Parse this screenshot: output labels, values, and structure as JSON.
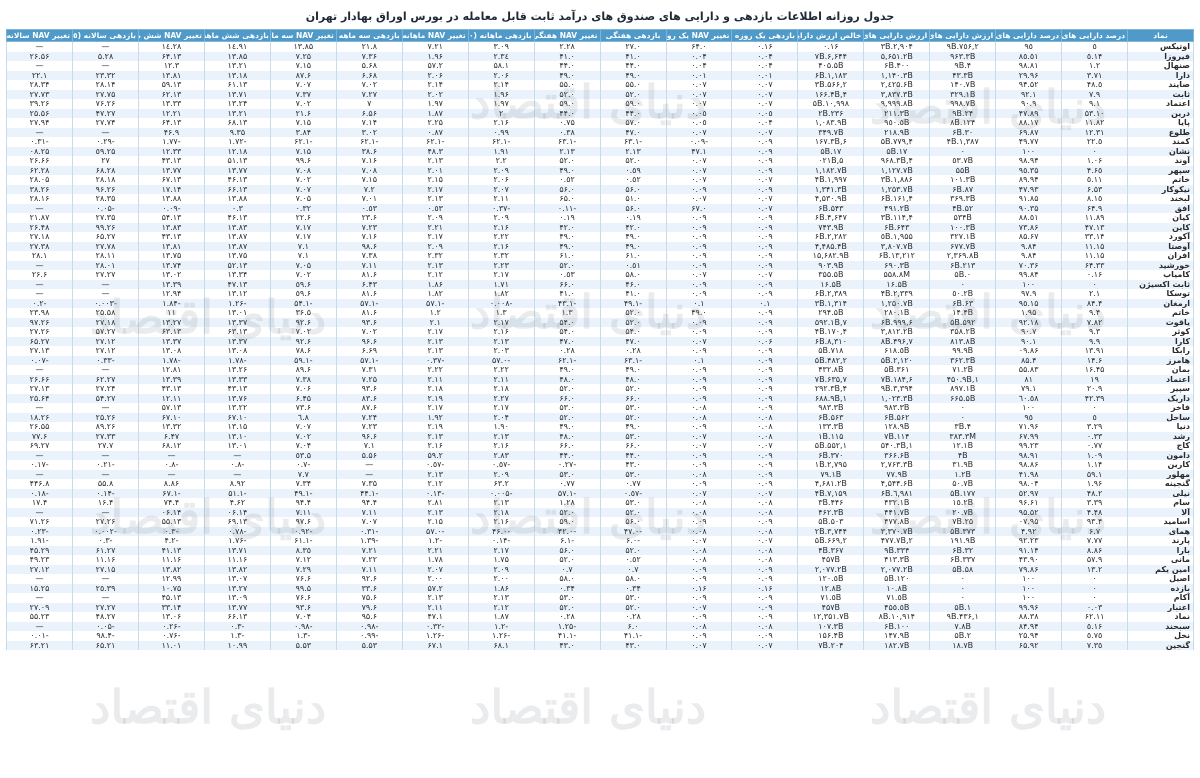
{
  "title": "جدول روزانه اطلاعات بازدهی و دارایی های صندوق های درآمد ثابت قابل معامله در بورس اوراق بهادار تهران",
  "watermark": "دنیای اقتصاد",
  "columns": [
    "نماد",
    "درصد دارایی های پرریسک",
    "درصد دارایی های کم ریسک",
    "ارزش دارایی های پرریسک",
    "ارزش دارایی های کم ریسک",
    "خالص ارزش دارایی ها",
    "بازدهی یک روزه",
    "تغییر NAV یک روزه",
    "بازدهی هفتگی",
    "تغییر NAV هفتگی (٧روزه)",
    "بازدهی ماهانه (٣٠روزه)",
    "تغییر NAV ماهانه (٣٠روزه)",
    "بازدهی سه ماهه (٩٠روزه)",
    "تغییر NAV سه ماهه (٩٠روزه)",
    "بازدهی شش ماهه (١٨٠روزه)",
    "تغییر NAV شش ماهه (١٨٠روزه)",
    "بازدهی سالانه (٣۶٥روزه)",
    "تغییر NAV سالانه (٣۶٥روزه)"
  ],
  "rows": [
    [
      "اوتیکس",
      "٥",
      "٩٥",
      "۲,٧٥۶.٩B",
      "۲,۹٠۴.٣B",
      "٠.١۶",
      "٠.١۶",
      "٠.۶۴",
      "٠.۲٧",
      "٢.٢٨",
      "٣.٠٩",
      "٧.٢١",
      "٨.۲١",
      "١٣.٨۵",
      "١٤.٩١",
      "١٤.٢٨",
      "—",
      "—"
    ],
    [
      "فیروزا",
      "١۴.٥",
      "٨٥.٥١",
      "۹۶٣.٣B",
      "۵,۶۵١.٢B",
      "۶,۶۴۴.٧B",
      "٠.٠۴",
      "٠.٠۴",
      "٠.۴١",
      "٠.۴١",
      "٢.٣٤",
      "١.٩۶",
      "٧.٣۶",
      "٧.٢۵",
      "١٣.٨۵",
      "١٣.۶۴",
      "٢٨.۵",
      "٢۶.۵۶"
    ],
    [
      "صنهال",
      "١.٢",
      "٩٨.٨١",
      "۴.٩B",
      "۴٠٠.۶B",
      "۴٠۵.۵B",
      "٠.٠۴",
      "٠.٠۴",
      "٠.۴۴",
      "٠.۴۴",
      "١.۵٨",
      "٢.۵٧",
      "۵.۶٨",
      "٧.١۵",
      "١٣.٢١",
      "١٢.٣",
      "—",
      "—"
    ],
    [
      "دارا",
      "٣.٧١",
      "٩۶.٢٩",
      "۴٣.٣B",
      "١,١۴٠.٣B",
      "١,١٨٣.۶B",
      "٠.٠١",
      "٠.٠١",
      "٠.۴٩",
      "٠.۴٩",
      "٢.٠۶",
      "٢.٠۶",
      "۶.۶٨",
      "۶.٨٧",
      "١٣.١٨",
      "١٣.٨١",
      "٢٣.٣٢",
      "٢٢.١"
    ],
    [
      "صایند",
      "٥.۴٨",
      "٩۴.۵٢",
      "١۴٠.٧B",
      "٢,٤٢۵.۶B",
      "٢,۵۶۶.٣B",
      "٠.٠٧",
      "٠.٠٧",
      "٠.۵۵",
      "٠.۵۵",
      "٢.١۴",
      "٢.١۴",
      "٧.٠٢",
      "٧.٠٧",
      "١٣.۶١",
      "١٣.۵٩",
      "٢٨.١۴",
      "٢٨.٣۴"
    ],
    [
      "ثابت",
      "٧.٩",
      "٩٢.١",
      "٣٢٩.١B",
      "٣,٨٣٧.٣B",
      "۴,١۶۶.۴B",
      "٠.٠٧",
      "٠.٠٧",
      "٠.۵۲",
      "٠.۵۲",
      "١.٩۶",
      "٢.٠٢",
      "٧.٢٧",
      "٧.٣٧",
      "١٣.٧١",
      "١٣.۶٢",
      "٢٧.٧۵",
      "٢٧.٧٣"
    ],
    [
      "اعتماد",
      "٩.١",
      "٩٠.٩",
      "٩٩٨.٧B",
      "٩,٩٩٩.٨B",
      "١٠,٩٩٨.۵B",
      "٠.٠٧",
      "٠.٠٧",
      "٠.۵٩",
      "٠.۵٩",
      "١.٩٧",
      "١.٩٧",
      "٧",
      "٧.٠٢",
      "١٣.٢۴",
      "١٣.٣٣",
      "٢۶.٧۶",
      "٢۶.٣٩"
    ],
    [
      "درین",
      "١٠.۵٣",
      "٨٩.۴٧",
      "٢۴.٩B",
      "٢١١.٣B",
      "٢٣۶.٢B",
      "٠.٠٥",
      "٠.٠٥",
      "٠.۴۴",
      "٠.۴۴",
      "٢",
      "١.٨٧",
      "۶.۵۶",
      "۶.٢١",
      "١٣.٢١",
      "١٢.٢١",
      "٢٧.۴٧",
      "٢۵.۵۶"
    ],
    [
      "پایا",
      "١١.٨٢",
      "٨٨.١٧",
      "١٢۴.٨B",
      "٩٥٠.٥B",
      "١,٠٨٣.٩B",
      "٠.٠۴",
      "٠.٠٥",
      "٠.۵٧",
      "٠.٧۵",
      "٢.١۶",
      "٢.٢۵",
      "٧.١۴",
      "٧.١۵",
      "١٣.۶٨",
      "١٣.۶۴",
      "٢٧.٧۴",
      "٢٧.٩۴"
    ],
    [
      "طلوع",
      "١٢.٣١",
      "٨٧.۶٩",
      "٣٠.۶B",
      "٢١٨.٩B",
      "٣۴٩.٧B",
      "٠.٠٧",
      "٠.٠٧",
      "٠.۴٧",
      "٠.٣٨",
      "٠.٩٩",
      "٠.٨٧",
      "٣.٠٢",
      "٣.٨۴",
      "٩.٣۵",
      "٩.۴۶",
      "—",
      "—"
    ],
    [
      "کمند",
      "٢٢.٥",
      "٧٧.۴٩",
      "١,٣٨٧.۴B",
      "۴,٧٧٩.۵B",
      "۶,١۶٧.٣B",
      "٠.٠٩",
      "-٠.٠٩",
      "-١.۶٣",
      "-١.۶٣",
      "-١.۶٢",
      "-١.۶٢",
      "-١.۶٢",
      "-١.۶٢",
      "-١.٧٢",
      "-١.٧٧",
      "-٠.٢٩",
      "-٠.٣١"
    ],
    [
      "نشان",
      "٠",
      "١٠٠",
      "٠",
      "١٧.۵B",
      "١٧.۵B",
      "٠.٠٩",
      "١.۴٧",
      "٢.١٣",
      "٢.١٣",
      "١.٩١",
      "٣.۴٨",
      "۶.٣٨",
      "٧.١۵",
      "١٢.١٨",
      "١٢.٣٣",
      "٢۵.٥٩",
      "٢۵.٠٨"
    ],
    [
      "آوند",
      "١.٠۶",
      "٩٨.٩۴",
      "٥٣.٧B",
      "۴,٩۶٨.٣B",
      "۵,٠٢١B",
      "٠.٠٩",
      "٠.٠٧",
      "٠.۵٢",
      "٠.۵٢",
      "٢.٢",
      "٢.١٣",
      "٧.١۶",
      "۶.٩٩",
      "١٣.۵١",
      "١٣.۴٣",
      "٢٧",
      "٢۶.۶۶"
    ],
    [
      "سپهر",
      "۴.۶٥",
      "٩٥.٣۵",
      "۵۵B",
      "١,١٢٧.٧B",
      "١,١٨٢.٧B",
      "٠.٠٩",
      "٠.٠٧",
      "٠.٥٩",
      "٠.۴٩",
      "٢.٠٩",
      "٢.٠١",
      "٧.٠٨",
      "٧.٠٨",
      "١٣.٧٧",
      "١٣.٧٧",
      "٢٨.۶٨",
      "٢٨.۶٢"
    ],
    [
      "خاتم",
      "٥.١١",
      "٩۴.٨٩",
      "١٠١.٣B",
      "١,٨٨۶.٣B",
      "١,٩٩٧.۴B",
      "٠.٠٧",
      "٠.٠٧",
      "٠.٥٢",
      "٠.٥٢",
      "٢.٠۶",
      "٢.١۵",
      "٧.١۵",
      "٧.٠٢",
      "١٣.۴۶",
      "١٣.۶٧",
      "٢٨.١٨",
      "٢٨.٠۵"
    ],
    [
      "نیکوکار",
      "۶.۵٣",
      "٩٣.۴٧",
      "٨٧.۶B",
      "١,٢۵٣.٧B",
      "١,٣۴١.٣B",
      "٠.٠٩",
      "٠.٠٩",
      "٠.۵۶",
      "٠.۵۶",
      "٢.٠٧",
      "٢.١٧",
      "٧.٢",
      "٧.٠٧",
      "١٣.۶۶",
      "١۴.١٧",
      "٢۶.٩۶",
      "٢۶.٣٨"
    ],
    [
      "لبخند",
      "٨.١٥",
      "٩١.٨۵",
      "٣۶٩.٣B",
      "۴,١۶١.۶B",
      "۴,۵٣٠.٩B",
      "٠.٠٧",
      "٠.٠٧",
      "٠.۵١",
      "٠.۶۵",
      "٢.١١",
      "٢.١٣",
      "٧.٠١",
      "٧.٠۵",
      "١٣.٨٨",
      "١٣.٨٨",
      "٢٨.٣۵",
      "٢٨.١۶"
    ],
    [
      "افق",
      "٩.۶۴",
      "٩٠.٣۵",
      "۵٢.۴B",
      "۴٩١.٢B",
      "۵۴٣.۶B",
      "٠.٠٧",
      "٠.۶٧",
      "٠.۵۶",
      "-٠.١١",
      "-٠.٣٧",
      "٠.٥٣",
      "٠.٥٣",
      "٠.٣٢",
      "٠.٣",
      "-٠.٠٩",
      "-٠.٠۵",
      "—"
    ],
    [
      "کیان",
      "١١.٨٩",
      "٨٨.٥١",
      "۵٣۴B",
      "۴,١١۴.٣B",
      "۴,۶۴٧.۶B",
      "٠.٠٩",
      "٠.٠٩",
      "٠.١٩",
      "٠.١٩",
      "٢.٠٩",
      "٢.٠٩",
      "۶.٢٣",
      "۶.٢٢",
      "١٣.۴۶",
      "١٣.۵۴",
      "٢٧.٣۵",
      "٢١.٨٧"
    ],
    [
      "کاین",
      "١٣.۴٧",
      "٨۶.٧٣",
      "١٠٠.٣B",
      "۶۴٣.۶B",
      "٧۴٣.٩B",
      "٠.٠٩",
      "٠.٠٩",
      "٠.۴٢",
      "٠.۴٢",
      "٢.١۶",
      "٢.٢١",
      "٧.٢٣",
      "٧.١٧",
      "١٣.٨٣",
      "١٣.٨٣",
      "٢۶.٩٩",
      "٢۶.۴٨"
    ],
    [
      "آکورد",
      "١۴.٣٣",
      "٨۵.۶٧",
      "٣٢٧.١B",
      "١,٩۵۵.٥B",
      "٢,٢٨٢.۶B",
      "٠.٠٩",
      "٠.٠٩",
      "٠.۴٩",
      "٠.۴٩",
      "٢.٢٢",
      "٢.١٧",
      "٧.١۶",
      "٧.١٧",
      "١٣.٨٧",
      "١٣.۴٣",
      "٢٧.۶۵",
      "٢٧.١٨"
    ],
    [
      "آوصتا",
      "١۵.١١",
      "٨۴.٩",
      "۶٧٧.٧B",
      "٣,٨٠٧.٧B",
      "۴,۴٨۵.۴B",
      "٠.٠٩",
      "٠.٠٩",
      "٠.۴٩",
      "٠.۴٩",
      "٢.١۶",
      "٢.٠٩",
      "۶.٩٨",
      "٧.١",
      "١٣.٨٧",
      "١٣.٨١",
      "٢٧.٧٨",
      "٢٧.٣٨"
    ],
    [
      "افران",
      "١۵.١١",
      "٨۴.٩",
      "٢,٣۶٩.٨B",
      "١٣,٢١٢.۶B",
      "١۵,۶٨٢.٩B",
      "٠.٠٩",
      "٠.٠٩",
      "٠.۶١",
      "٠.۶١",
      "٢.٣٢",
      "٢.٣٢",
      "٧.٣٨",
      "٧.١",
      "١٣.٧۵",
      "١٣.٧۵",
      "٢٨.١١",
      "٢٨.١"
    ],
    [
      "خورشید",
      "٣٣.۶۴",
      "٧٠.٣۶",
      "٢١٣.۶B",
      "۶٩٠.٣B",
      "٩٠٣.٩B",
      "٠.٠٩",
      "٠.٠٩",
      "٠.٥١",
      "٠.۵٢",
      "٢.٢٣",
      "٢.١٣",
      "٧.١١",
      "٧.٠۵",
      "١٣.۵٢",
      "١٣.٧۴",
      "٢٨.٠١",
      "—"
    ],
    [
      "کامیاب",
      "٠.١۶",
      "٩٩.٨۴",
      "٠.۵B",
      "۵۵٨.٨M",
      "٣۵۵.۵B",
      "٠.٠٧",
      "٠.٠٧",
      "٠.۵٨",
      "٠.٥٣",
      "٢.١٧",
      "٢.١٢",
      "۶.٨١",
      "٧.٠٢",
      "١٣.٣۴",
      "١٣.٠٢",
      "٢٧.٢٧",
      "٢۶.۶"
    ],
    [
      "ثابت اکسیژن",
      "٠",
      "١٠٠",
      "٠",
      "١۶.۵B",
      "١۶.۵B",
      "٠.٠٩",
      "٠.٠٩",
      "٠.۴۶",
      "٠.۶۶",
      "١.٧١",
      "١.٨۶",
      "۶.۴٣",
      "۶.٥٩",
      "١٣.۴٧",
      "١٣.٣٩",
      "—",
      "—"
    ],
    [
      "توسکا",
      "٢.١",
      "٩٧.٩",
      "٥٠.٢B",
      "٢,٣٣٩.۴B",
      "٢,٣٨٩.۶B",
      "٠.٠٩",
      "٠.٠٩",
      "٠.۴١",
      "٠.۴١",
      "١.٨٢",
      "١.٨٢",
      "۶.٨١",
      "۶.٥٩",
      "١٣.١٢",
      "١٢.٩۴",
      "—",
      "—"
    ],
    [
      "ارمغان",
      "۴.٨۴",
      "٩٥.١۵",
      "۶٣.۶B",
      "١,٢۵٠.٧B",
      "١,٣١۴.٣B",
      "٠.١",
      "٠.١",
      "-١.۴٩",
      "-١.۴٣",
      "-٠.٠٠٨",
      "-١.۵٧",
      "-١.۵٧",
      "-١.۵۴",
      "-١.٢۶",
      "-١.٨۴",
      "-٠.٠٠٣",
      "-٠.٢"
    ],
    [
      "خاتم",
      "۴.٩",
      "٩۵.١",
      "١۴.۴B",
      "٢٨٠.١B",
      "٢٩۴.۵B",
      "٠.٠٩",
      "٠.۴٩",
      "٠.۵٢",
      "١.٣",
      "١.٣",
      "١.٢",
      "۶.٨١",
      "۵.٣۶",
      "١٣.٠١",
      "١١",
      "٢۵.۵٨",
      "٢٣.٩٨"
    ],
    [
      "یاقوت",
      "٧.٨٢",
      "٩٢.١٨",
      "۵٩٢.۵B",
      "۶,٩٩٩.۶B",
      "٧,۵٩٢.١B",
      "٠.٠٩",
      "٠.٠٩",
      "٠.۵٢",
      "٠.۵۴",
      "٢.١٧",
      "٢.١",
      "۶.٩٣",
      "۶.٩٢",
      "١٣.٣٧",
      "١٣.٢٧",
      "٢٧.١٨",
      "٢۶.٩٧"
    ],
    [
      "کوثر",
      "٩.٣",
      "٩٠.٧",
      "٣۵٨.٢B",
      "٣,٨١٢.٢B",
      "۴,١٧٠.۴B",
      "٠.٠٩",
      "٠.٠٩",
      "٠.۵۴",
      "٠.۵۴",
      "٢.١۶",
      "٢.١٧",
      "٧.٠٢",
      "٧.٠٢",
      "١٣.۶٣",
      "١٣.۶٣",
      "٢٧.۵٧",
      "٢٧.٢۶"
    ],
    [
      "کارا",
      "٩.٩",
      "٩٠.١",
      "٨١٣.٨B",
      "٧,۴٩۶.٨B",
      "٨,٣١٠.۶B",
      "٠.٠۶",
      "٠.٠٧",
      "٠.۴٧",
      "٠.۴٧",
      "٢.١٣",
      "٢.١٣",
      "۶.٩۶",
      "۶.٩٢",
      "١٣.٣٧",
      "١٣.٣٧",
      "٢٧.١٢",
      "٢٧.۶۵"
    ],
    [
      "رابکا",
      "١٣.٩١",
      "٨۶.٠٩",
      "٩٩.٩B",
      "۶١٨.٥B",
      "٧١٨.۵B",
      "٠.٠٩",
      "٠.٠٩",
      "٠.٢٨",
      "٠.٢٨",
      "٢.٠٣",
      "٢.١٣",
      "۶.۶٩",
      "۶.٧٨",
      "١٣.٠٨",
      "١٣.٠٨",
      "٢٧.١٢",
      "٢٧.١٣"
    ],
    [
      "هامرز",
      "١۴.۶",
      "٨۵.۴",
      "٣۶٢.٣B",
      "٢,١٢٠.۵B",
      "٢,۴٨٢.۵B",
      "٠.٠٩",
      "٠.١",
      "-١.۶٣",
      "-١.۶٢",
      "-٠.۵٧",
      "-٠.٣٧",
      "-١.۵٧",
      "-١.۵٩",
      "-١.٧٨",
      "-١.٧٨",
      "-٠.٣٣",
      "-٠.٠٧"
    ],
    [
      "بمان",
      "١۶.۴۵",
      "٨٣.۵۵",
      "٧١.٢B",
      "٣۶١.۵B",
      "۴٣٢.٨B",
      "٠.٠٩",
      "٠.٠٩",
      "٠.۴٩",
      "٠.۴٩",
      "٢.٢٢",
      "٢.٢٢",
      "٧.٣١",
      "۶.٨٩",
      "١٣.٢۶",
      "١٢.٨١",
      "—",
      "—"
    ],
    [
      "اعتماد",
      "١٩",
      "٨١",
      "١,۴۵٠.٩B",
      "۶,١٨۴.٧B",
      "٧,۶٣۵.٧B",
      "٠.٠٩",
      "٠.٠٩",
      "٠.۴٨",
      "٠.۴٨",
      "٢.١١",
      "٢.١١",
      "٧.٢۵",
      "٧.٣٨",
      "١٣.٣٣",
      "١٣.٣٩",
      "٢٧.۶٢",
      "٢۶.۶۶"
    ],
    [
      "سپیر",
      "٢٠.٩",
      "٧٩.١",
      "٨٩٧.١B",
      "٣,٣٩۴.٩B",
      "۴,٢٩٢.٣B",
      "٠.٠٩",
      "٠.٠٩",
      "٠.۵٢",
      "٠.۵٢",
      "٢.١٨",
      "٢.١٨",
      "۶.٩٣",
      "٧.٠۶",
      "١٣.۴٣",
      "١٣.۴٣",
      "٢٧.٢۴",
      "٢٧.١٣"
    ],
    [
      "داریک",
      "٣٩.۴٢",
      "٦٠.٥٨",
      "۶۶۵.۵B",
      "١,٠٢٣.٣B",
      "١,۶٨٨.٩B",
      "٠.٠٩",
      "٠.٠٩",
      "٠.۶۶",
      "٠.۶۶",
      "٢.٢٧",
      "٢.١٩",
      "۶.٨٣",
      "۶.۴۵",
      "١٣.٧۶",
      "١٢.١١",
      "٢٧.۵۴",
      "٢۵.۶۴"
    ],
    [
      "فاخر",
      "٠",
      "١٠٠",
      "٠",
      "٩٨٣.٣B",
      "٩٨٣.٣B",
      "٠.٠٩",
      "٠.٠٨",
      "٠.۵٣",
      "٠.۵٣",
      "٢.١٧",
      "٢.١٧",
      "۶.٨٧",
      "۶.٧٣",
      "١٣.٢٢",
      "١٣.۵٧",
      "—",
      "—"
    ],
    [
      "ساحل",
      "٥",
      "٩٥",
      "٠",
      "۵۶٢.۶B",
      "۵۶٣.۶B",
      "٠.٠٨",
      "٠.٠٨",
      "٠.۵٢",
      "٠.۵٢",
      "٢.٠۴",
      "١.٩٢",
      "٧.٢۴",
      "٦.٨",
      "١٠.۶٧",
      "١٠.۶٧",
      "٢۶.٢۵",
      "٢۶.١٨"
    ],
    [
      "دنیا",
      "٣.٢٩",
      "٩۶.٧١",
      "۴.٣B",
      "١٢٨.٩B",
      "١٣٣.٣B",
      "٠.٠٨",
      "٠.٠٩",
      "٠.۴٩",
      "٠.۴٩",
      "١.٩٠",
      "٢.١٩",
      "٧.٢٣",
      "٧.٠٧",
      "١٣.١۵",
      "١٣.٣٢",
      "٢۶.٨٩",
      "٢۶.۵۵"
    ],
    [
      "رشد",
      "٠.٣٣",
      "٩٩.۶٧",
      "٣٨٣.٣M",
      "١١۴.٧B",
      "١١۵.١B",
      "٠.٠٨",
      "٠.٠٧",
      "٠.۵٣",
      "٠.۴٨",
      "٢.١٣",
      "٢.١٣",
      "۶.٩۶",
      "٧.٠٢",
      "١٣.١٠",
      "۶.۴٧",
      "٢٧.٣٣",
      "۶.٧٧"
    ],
    [
      "کاج",
      "٠.٧٧",
      "٩٩.٢٣",
      "١٢.١B",
      "١,۵۴٠.٣B",
      "١,۵۵٢.۵B",
      "٠.٠٧",
      "٠.٠٧",
      "٠.۶۶",
      "٠.۶۶",
      "٢.١۶",
      "٢.١۶",
      "٧.١",
      "٧.٠۴",
      "١٣.٠١",
      "١٢.۶٨",
      "٢٧.٧",
      "٢٧.۶٩"
    ],
    [
      "دامون",
      "١.٠٩",
      "٩٨.٩١",
      "۴B",
      "٣۶۶.۶B",
      "٣٧٠.۶B",
      "٠.٠٩",
      "٠.٠٩",
      "٠.۴۴",
      "٠.۴۴",
      "٢.٨٣",
      "٢.۵٩",
      "۵.۵۶",
      "۵.٥٣",
      "—",
      "—",
      "—",
      "—"
    ],
    [
      "کارین",
      "١.١۴",
      "٩٨.٨۶",
      "٣١.٩B",
      "٢,٧۶٣.٣B",
      "٢,٧٩۵.١B",
      "٠.٠٩",
      "٠.٠٩",
      "٠.۴٣",
      "-٠.٢٧",
      "-٠.٥٧",
      "-٠.٥٧",
      "—",
      "-٠.٧",
      "-٠.٨",
      "-٠.٨",
      "-٠.٢١",
      "-٠.١٧"
    ],
    [
      "مهلور",
      "١.۵٩",
      "٩٨.۴١",
      "١.٢B",
      "٧٧.٩B",
      "٧٩.١B",
      "٠.٠٩",
      "٠.٠٨",
      "٠.۵٣",
      "٠.۵٣",
      "٢.٠٩",
      "٢.١٣",
      "—",
      "٧.٧",
      "—",
      "—",
      "—",
      "—"
    ],
    [
      "گنجینه",
      "١.٩۶",
      "٩٨.٠۴",
      "۵٠.٧B",
      "۴,۵۴۴.۶B",
      "۴,۶٨١.٢B",
      "٠.٠٩",
      "٠.٠٩",
      "٠.٧٧",
      "٠.٧٧",
      "٢.۶٣",
      "٢.١٢",
      "٧.٣۵",
      "٧.٣۴",
      "٨.٩٢",
      "٨.٨۶",
      "٨.۵۵",
      "٨.۴۴۶"
    ],
    [
      "نیلی",
      "٢.۴٨",
      "٩٧.۵٢",
      "١٧٧.۵B",
      "٦,٩٨١.۶B",
      "٧,١۵٩.۴B",
      "٠.٠٧",
      "٠.٠٧",
      "-٠.٥٧",
      "-١.۵٧",
      "-٠.٠٠۵",
      "-٠.١٣",
      "-١.۴۴",
      "-١.۴٩",
      "-١.۵١",
      "-١.۶٧",
      "-٠.١۴",
      "-٠.١٨"
    ],
    [
      "سام",
      "٣.٣٩",
      "٩۶.۶١",
      "١٥.٢B",
      "۴٣٢.١B",
      "۴۴۶.٣B",
      "٠.٠٨",
      "٠.٠٨",
      "٠.۵٣",
      "١.٢٨",
      "٢.١٣",
      "٢.٨١",
      "۴.٩۴",
      "۴.٩۴",
      "۴.۶٢",
      "۴.٧۴",
      "۴.١۶",
      "۴.١٧"
    ],
    [
      "آلا",
      "۴.۴٨",
      "٩۵.۵٢",
      "٢٠.٧B",
      "۴۴١.٧B",
      "۴۶٢.٣B",
      "٠.٠٨",
      "٠.٠٨",
      "٠.۵٢",
      "٠.۵٢",
      "٢.١٨",
      "٢.١٣",
      "٧.١١",
      "٧.١١",
      "١۴.٠۶",
      "١۴.٠۶",
      "—",
      "—"
    ],
    [
      "اسامید",
      "۴.٩٣",
      "٩۵.٠٧",
      "٢۵.٧B",
      "۴٧٧.٨B",
      "۵٠٣.۵B",
      "٠.٠٩",
      "٠.٠٩",
      "٠.۵۶",
      "٠.۵٩",
      "٢.١۶",
      "٢.١۵",
      "٧.٠٧",
      "۶.٩٧",
      "١٣.۶٩",
      "١٣.۵۵",
      "٢٧.٢۶",
      "٢۶.٧١"
    ],
    [
      "همای",
      "٧.۶",
      "٩٢.۴",
      "٣٧٣.۵B",
      "٣,٣٧٠.٧B",
      "٣,٧۴۴.٢B",
      "٠.٠٨",
      "٠.٠٨",
      "-٠.۴٧",
      "-٠.۴٢",
      "-٠.۴۶",
      "-٠.۵٧",
      "-٠.٣١",
      "-٠.٩٢",
      "-٠.٧٨",
      "-٠.٣",
      "-٠.٠٠٢",
      "-٠.٢٣"
    ],
    [
      "پارند",
      "٧.٧٧",
      "٩٢.٢٣",
      "١٩١.٩B",
      "٢,۴٧٧.٧B",
      "٢,۶۶٩.۵B",
      "٠.٠٧",
      "٠.٠٧",
      "-٠.۶",
      "-١.۶",
      "-٠.١۴",
      "-١.٢",
      "-١.٣٩",
      "-١.۶١",
      "-١.٧۶",
      "-٢.۴",
      "-٠.٣",
      "-١.٩١"
    ],
    [
      "بارا",
      "٨.٨۶",
      "٩١.١۴",
      "٣٢.۶B",
      "٣٣۴.٩B",
      "٣۶٧.۴B",
      "٠.٠٨",
      "٠.٠٨",
      "٠.۵٢",
      "٠.۵۶",
      "٢.١٧",
      "٢.٢١",
      "٧.٢١",
      "٨.٣٥",
      "١٣.٧١",
      "١٣.۴١",
      "٢٧.۶١",
      "٢٩.۴۵"
    ],
    [
      "مانی",
      "٩.۵٧",
      "٩٠.۴٣",
      "٣٣٧.۶B",
      "۴١٣.٣B",
      "۴۵٧B",
      "٠.٠٨",
      "٠.٠٨",
      "٠.٥٢",
      "٠.۵٢",
      "١.٧۵",
      "١.٧٨",
      "٧.٢٢",
      "٧.١٢",
      "١١.١۶",
      "١١.١۶",
      "١١.١۶",
      "٢٣.۴٩"
    ],
    [
      "امین یکم",
      "١٣.٢",
      "٨۶.٧٩",
      "۵٨.۵B",
      "٢,٠٧٧.٢B",
      "٢,٠٧٧.٢B",
      "٠.٠٩",
      "٠.٠٩",
      "٠.٧",
      "٠.٧",
      "٢.٠٩",
      "٢.٠٧",
      "٧.١١",
      "٧.٢٩",
      "١٣.٨٢",
      "١٣.٨٢",
      "٢٧.١۵",
      "٢٧.١٢"
    ],
    [
      "اصیل",
      "٠",
      "١٠٠",
      "٠",
      "١٢٠.۵B",
      "١٢٠.٥B",
      "٠.٠٩",
      "٠.٠٩",
      "٠.۵٨",
      "٠.۵٨",
      "٢.٠٠",
      "٢.٠٠",
      "۶.٩٢",
      "۶.٧۶",
      "١٣.٠٧",
      "١٢.٩٩",
      "—",
      "—"
    ],
    [
      "بازده",
      "٠",
      "١٠٠",
      "٠",
      "١٠.٨B",
      "١٢.٨B",
      "٠.١۶",
      "٠.١۶",
      "٠.٣۴",
      "٠.٣۴",
      "١.٨۶",
      "٢.۵٧",
      "۶.٣٣",
      "۵.٩٩",
      "١٣.٢٧",
      "١٠.٧۵",
      "٢٥.٣٩",
      "٢۵.١۵"
    ],
    [
      "آکام",
      "٠",
      "١٠٠",
      "٠",
      "٧١.٥B",
      "٧١.٥B",
      "٠.٠٩",
      "٠.٠٩",
      "٠.۵٣",
      "٠.۵٣",
      "٢.١٣",
      "٢.١٣",
      "۶.٧۵",
      "۶.٧۶",
      "١٣.٠٩",
      "١٣.۴۵",
      "—",
      "—"
    ],
    [
      "اعتبار",
      "٠.٠٣",
      "٩٩.٩۶",
      "١.۵B",
      "۴۵٥.٥B",
      "۴۵٧B",
      "٠.٠٩",
      "٠.٠٧",
      "٠.۵٢",
      "٠.۵٢",
      "٢.١٢",
      "٢.١١",
      "۶.٧٩",
      "۶.٩٣",
      "١٣.٧٧",
      "١۴.٣٣",
      "٢٧.٢٧",
      "٢٧.٠٩"
    ],
    [
      "نماد",
      "١١.۶٢",
      "٨٨.٣٨",
      "١,۴٣۶.٩B",
      "١٠,٩١۴.٨B",
      "١٢,٣۵١.٧B",
      "٠.٠٩",
      "٠.٠٩",
      "٠.٢٨",
      "٠.٢٨",
      "١.٨٧",
      "١.۴٧",
      "۶.٩۵",
      "٧.٠۴",
      "١٣.۶۶",
      "١٣.٠۶",
      "٢٧.۴٨",
      "٢٣.۵۵"
    ],
    [
      "سبحند",
      "٥.١۶",
      "٩۴.٨۴",
      "٧.٨B",
      "١٠٠.۶B",
      "١٠٧.٣B",
      "٠.٠٨",
      "٠.٠٨",
      "٠.۶",
      "-١.٢۵",
      "-١.٢",
      "-٠.٣٢",
      "-٠.٩٨",
      "-٠.٩٨",
      "-٠.٣",
      "-٠.٢۶",
      "-٠.٠۵",
      "—"
    ],
    [
      "نخل",
      "٥.٧٥",
      "٩۴.٢۵",
      "٢.۵B",
      "١۴٧.٩B",
      "١۵۶.۴B",
      "٠.٠٩",
      "٠.٠٩",
      "-١.۴١",
      "-١.۴١",
      "-١.٢۶",
      "-١.٢۶",
      "-٠.٩٩",
      "-١.٣",
      "-١.٣",
      "-٠.٧۶",
      "-۴.٩٨",
      "-٠.٠١"
    ],
    [
      "گنجین",
      "٧.٣٥",
      "٩٢.۶۵",
      "١٨.٧B",
      "١٨٢.٧B",
      "٢٠۴.٧B",
      "٠.٠٧",
      "٠.٠٧",
      "٠.۴٣",
      "٠.۴٣",
      "١.۶٨",
      "١.۶٧",
      "۵.۵٣",
      "۵.۵٣",
      "١٠.٩٩",
      "١١.٠١",
      "٢١.۶۵",
      "٢١.۶٣"
    ]
  ]
}
